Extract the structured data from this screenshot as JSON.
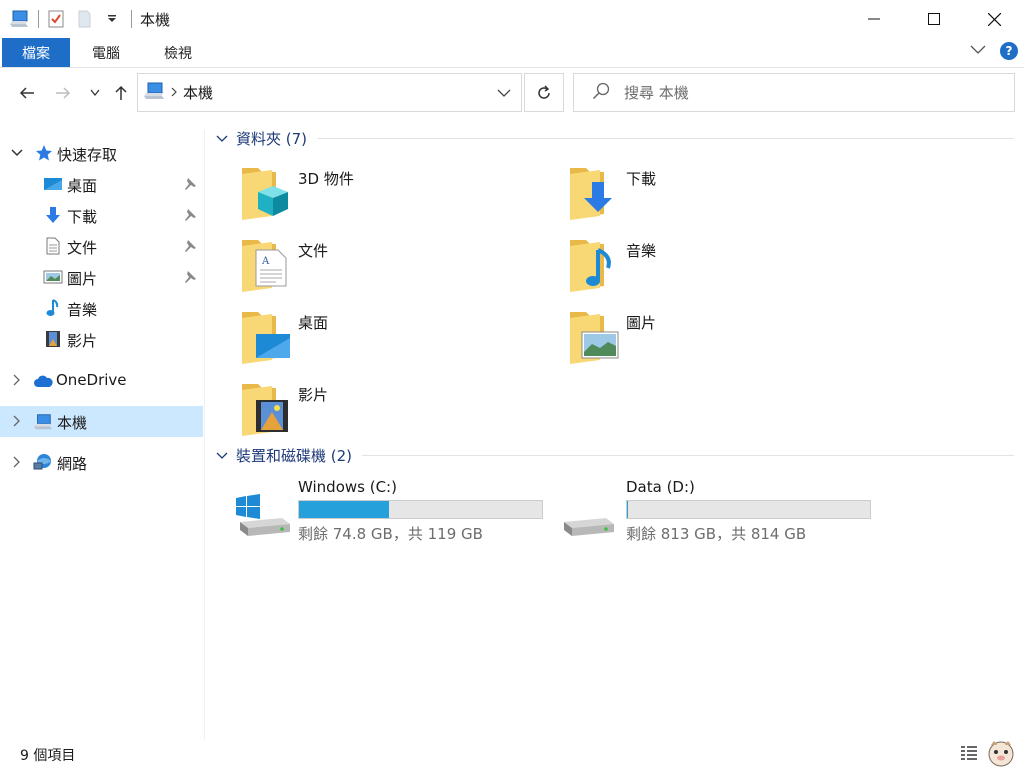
{
  "window": {
    "title": "本機"
  },
  "ribbon": {
    "tabs": [
      "檔案",
      "電腦",
      "檢視"
    ],
    "help_label": "?"
  },
  "address": {
    "crumb": "本機"
  },
  "search": {
    "placeholder": "搜尋 本機"
  },
  "sidebar": {
    "quick_access": "快速存取",
    "pinned": [
      "桌面",
      "下載",
      "文件",
      "圖片"
    ],
    "unpinned": [
      "音樂",
      "影片"
    ],
    "onedrive": "OneDrive",
    "this_pc": "本機",
    "network": "網路"
  },
  "groups": {
    "folders_title": "資料夾 (7)",
    "devices_title": "裝置和磁碟機 (2)"
  },
  "folders": [
    {
      "name": "3D 物件",
      "icon": "3d-objects-folder-icon"
    },
    {
      "name": "下載",
      "icon": "downloads-folder-icon"
    },
    {
      "name": "文件",
      "icon": "documents-folder-icon"
    },
    {
      "name": "音樂",
      "icon": "music-folder-icon"
    },
    {
      "name": "桌面",
      "icon": "desktop-folder-icon"
    },
    {
      "name": "圖片",
      "icon": "pictures-folder-icon"
    },
    {
      "name": "影片",
      "icon": "videos-folder-icon"
    }
  ],
  "drives": [
    {
      "name": "Windows (C:)",
      "free": "剩餘 74.8 GB，共 119 GB",
      "used_fraction": 0.37,
      "icon": "windows-drive-icon"
    },
    {
      "name": "Data (D:)",
      "free": "剩餘 813 GB，共 814 GB",
      "used_fraction": 0.001,
      "icon": "data-drive-icon"
    }
  ],
  "status": {
    "item_count": "9 個項目"
  },
  "colors": {
    "accent": "#1e6ec7",
    "selection": "#cce8ff",
    "bar_fill": "#26a0da",
    "group_header": "#1e3a78"
  }
}
